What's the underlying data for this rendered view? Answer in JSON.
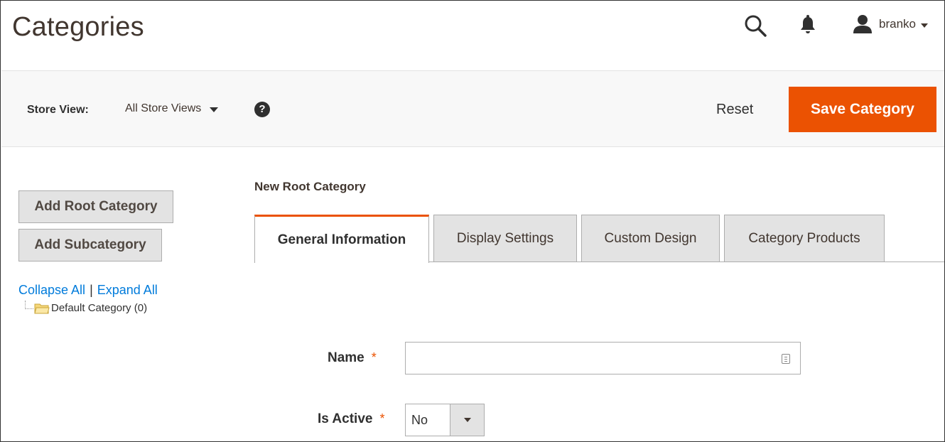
{
  "header": {
    "title": "Categories",
    "user": "branko",
    "icons": [
      "search-icon",
      "bell-icon",
      "user-icon"
    ]
  },
  "toolbar": {
    "store_label": "Store View:",
    "store_value": "All Store Views",
    "help_glyph": "?",
    "reset_label": "Reset",
    "save_label": "Save Category",
    "save_color": "#eb5202"
  },
  "sidebar": {
    "add_root_label": "Add Root Category",
    "add_sub_label": "Add Subcategory",
    "collapse_label": "Collapse All",
    "separator": "|",
    "expand_label": "Expand All",
    "tree": [
      {
        "label": "Default Category (0)",
        "icon": "folder-icon"
      }
    ]
  },
  "main": {
    "section_title": "New Root Category",
    "tabs": [
      {
        "label": "General Information",
        "active": true
      },
      {
        "label": "Display Settings",
        "active": false
      },
      {
        "label": "Custom Design",
        "active": false
      },
      {
        "label": "Category Products",
        "active": false
      }
    ],
    "fields": {
      "name": {
        "label": "Name",
        "required_mark": "*",
        "value": ""
      },
      "is_active": {
        "label": "Is Active",
        "required_mark": "*",
        "value": "No"
      }
    }
  },
  "colors": {
    "accent": "#eb5202",
    "link": "#007bdb",
    "toolbar_bg": "#f8f8f8",
    "button_gray": "#e3e3e3"
  }
}
